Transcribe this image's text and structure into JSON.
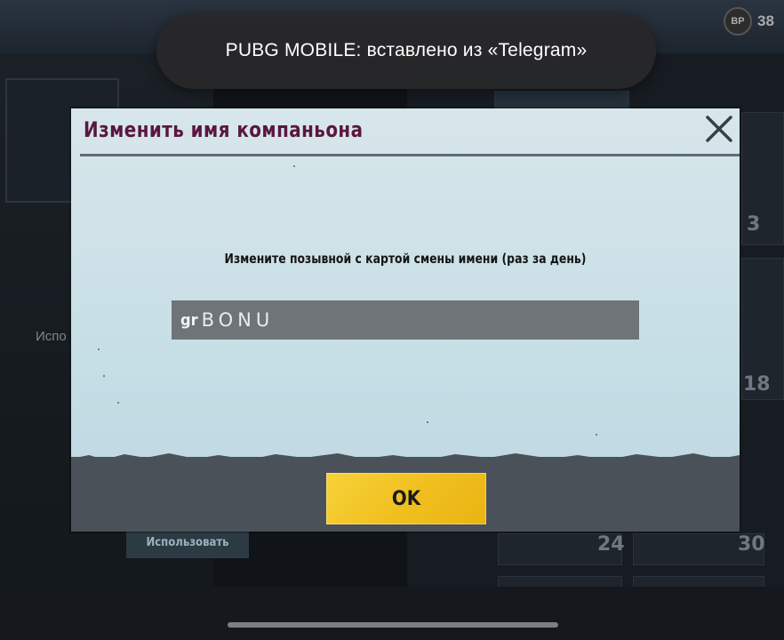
{
  "toast": {
    "message": "PUBG MOBILE: вставлено из «Telegram»"
  },
  "dialog": {
    "title": "Изменить имя компаньона",
    "prompt": "Измените позывной с картой смены имени (раз за день)",
    "name_input": {
      "prefix": "gr",
      "value": "BONU"
    },
    "ok_label": "OK"
  },
  "background": {
    "coin_count": "38",
    "use_button_label": "Использовать",
    "side_text": "Испо",
    "tile_numbers": [
      "3",
      "18",
      "24",
      "30"
    ]
  },
  "colors": {
    "title_color": "#5a1640",
    "ok_button_yellow": "#f0bf1e",
    "input_bg": "#6f7478"
  },
  "icons": {
    "close": "close-icon"
  }
}
